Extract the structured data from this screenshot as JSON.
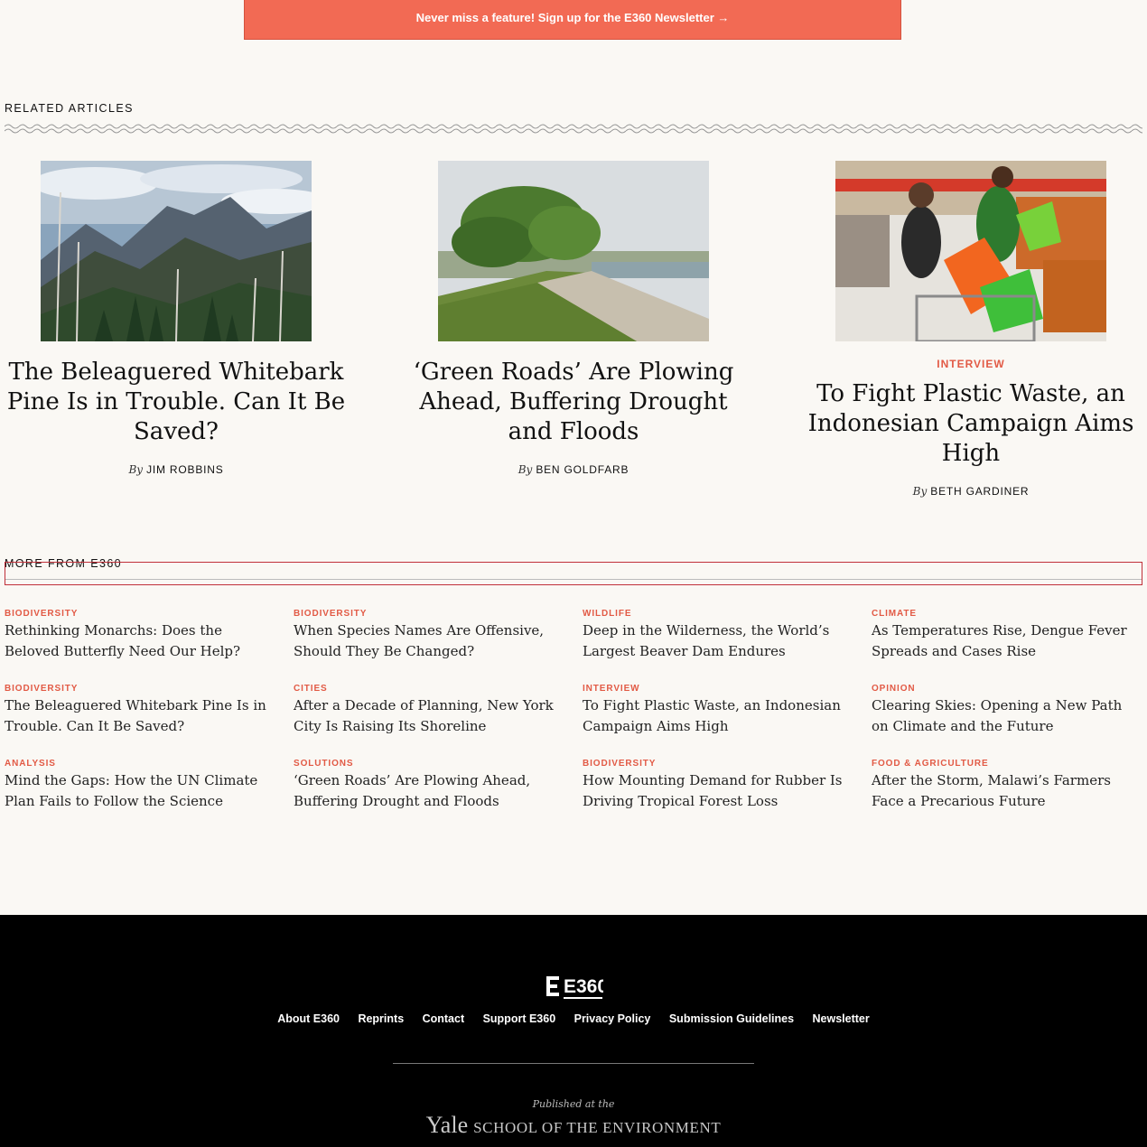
{
  "newsletter": {
    "text": "Never miss a feature! Sign up for the E360 Newsletter →"
  },
  "related": {
    "heading": "RELATED ARTICLES",
    "articles": [
      {
        "image": "mountain-forest-photo",
        "rubric": "",
        "title": "The Beleaguered Whitebark Pine Is in Trouble. Can It Be Saved?",
        "by": "By",
        "author": "JIM ROBBINS"
      },
      {
        "image": "green-road-trees-photo",
        "rubric": "",
        "title": "‘Green Roads’ Are Plowing Ahead, Buffering Drought and Floods",
        "by": "By",
        "author": "BEN GOLDFARB"
      },
      {
        "image": "supermarket-bags-photo",
        "rubric": "INTERVIEW",
        "title": "To Fight Plastic Waste, an Indonesian Campaign Aims High",
        "by": "By",
        "author": "BETH GARDINER"
      }
    ]
  },
  "more": {
    "heading": "MORE FROM E360",
    "items": [
      {
        "rubric": "BIODIVERSITY",
        "title": "Rethinking Monarchs: Does the Beloved Butterfly Need Our Help?"
      },
      {
        "rubric": "BIODIVERSITY",
        "title": "When Species Names Are Offensive, Should They Be Changed?"
      },
      {
        "rubric": "WILDLIFE",
        "title": "Deep in the Wilderness, the World’s Largest Beaver Dam Endures"
      },
      {
        "rubric": "CLIMATE",
        "title": "As Temperatures Rise, Dengue Fever Spreads and Cases Rise"
      },
      {
        "rubric": "BIODIVERSITY",
        "title": "The Beleaguered Whitebark Pine Is in Trouble. Can It Be Saved?"
      },
      {
        "rubric": "CITIES",
        "title": "After a Decade of Planning, New York City Is Raising Its Shoreline"
      },
      {
        "rubric": "INTERVIEW",
        "title": "To Fight Plastic Waste, an Indonesian Campaign Aims High"
      },
      {
        "rubric": "OPINION",
        "title": "Clearing Skies: Opening a New Path on Climate and the Future"
      },
      {
        "rubric": "ANALYSIS",
        "title": "Mind the Gaps: How the UN Climate Plan Fails to Follow the Science"
      },
      {
        "rubric": "SOLUTIONS",
        "title": "‘Green Roads’ Are Plowing Ahead, Buffering Drought and Floods"
      },
      {
        "rubric": "BIODIVERSITY",
        "title": "How Mounting Demand for Rubber Is Driving Tropical Forest Loss"
      },
      {
        "rubric": "FOOD & AGRICULTURE",
        "title": "After the Storm, Malawi’s Farmers Face a Precarious Future"
      }
    ]
  },
  "footer": {
    "logo_text": "E360",
    "links": [
      "About E360",
      "Reprints",
      "Contact",
      "Support E360",
      "Privacy Policy",
      "Submission Guidelines",
      "Newsletter"
    ],
    "published": "Published at the",
    "yale": "Yale",
    "school": "SCHOOL OF THE ENVIRONMENT"
  },
  "colors": {
    "accent": "#f26a54",
    "rubric": "#e25a45",
    "background": "#faf8f4",
    "footer": "#000000"
  }
}
